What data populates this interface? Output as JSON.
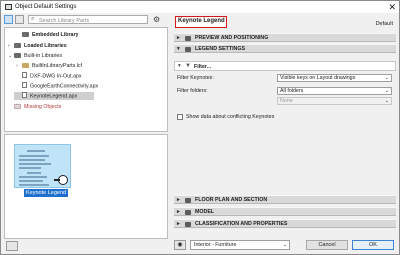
{
  "window": {
    "title": "Object Default Settings",
    "close_glyph": "✕"
  },
  "search": {
    "placeholder": "Search Library Parts"
  },
  "toolbar": {
    "gear_glyph": "⚙"
  },
  "tree": [
    {
      "label": "Embedded Library",
      "indent": 1,
      "expander": "",
      "icon": "folder",
      "group": true
    },
    {
      "label": "Loaded Libraries",
      "indent": 0,
      "expander": "›",
      "icon": "folder",
      "group": true
    },
    {
      "label": "Built-in Libraries",
      "indent": 0,
      "expander": "⌄",
      "icon": "folder",
      "group": false
    },
    {
      "label": "BuiltInLibraryParts.lcf",
      "indent": 1,
      "expander": "›",
      "icon": "folder-light",
      "group": false
    },
    {
      "label": "DXF-DWG In-Out.apx",
      "indent": 1,
      "expander": "",
      "icon": "file",
      "group": false
    },
    {
      "label": "GoogleEarthConnectivity.apx",
      "indent": 1,
      "expander": "",
      "icon": "file",
      "group": false
    },
    {
      "label": "KeynoteLegend.apx",
      "indent": 1,
      "expander": "",
      "icon": "file",
      "group": false,
      "selected": true
    },
    {
      "label": "Missing Objects",
      "indent": 0,
      "expander": "",
      "icon": "missing",
      "group": false,
      "missing": true
    }
  ],
  "preview": {
    "caption": "Keynote Legend"
  },
  "settings": {
    "object_name": "Keynote Legend",
    "default_label": "Default",
    "sections_top": [
      {
        "label": "PREVIEW AND POSITIONING",
        "arrow": "▸"
      },
      {
        "label": "LEGEND SETTINGS",
        "arrow": "▾"
      }
    ],
    "filter": {
      "label": "Filter...",
      "arrow": "▾",
      "icon": "▼"
    },
    "filter_keynotes": {
      "label": "Filter Keynotes:",
      "value": "Visible keys on Layout drawings"
    },
    "filter_folders": {
      "label": "Filter folders:",
      "value": "All folders",
      "sub_value": "None"
    },
    "conflict_checkbox": {
      "label": "Show data about conflicting Keynotes",
      "checked": false
    },
    "sections_bottom": [
      {
        "label": "FLOOR PLAN AND SECTION",
        "arrow": "▸"
      },
      {
        "label": "MODEL",
        "arrow": "▸"
      },
      {
        "label": "CLASSIFICATION AND PROPERTIES",
        "arrow": "▸"
      }
    ],
    "layer": {
      "value": "Interior - Furniture"
    },
    "cancel_label": "Cancel",
    "ok_label": "OK"
  }
}
